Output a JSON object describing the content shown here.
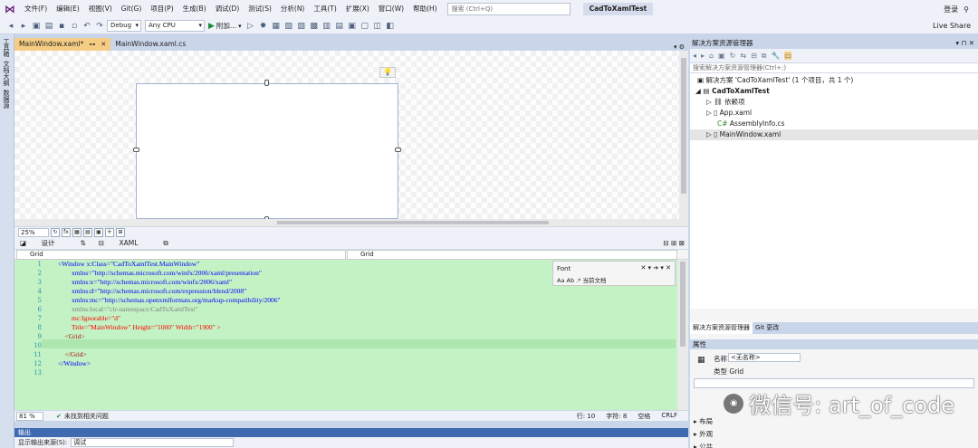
{
  "app": {
    "menu": [
      "文件(F)",
      "编辑(E)",
      "视图(V)",
      "Git(G)",
      "项目(P)",
      "生成(B)",
      "调试(D)",
      "测试(S)",
      "分析(N)",
      "工具(T)",
      "扩展(X)",
      "窗口(W)",
      "帮助(H)"
    ],
    "search_placeholder": "搜索 (Ctrl+Q)",
    "solution_name": "CadToXamlTest",
    "login": "登录",
    "live_share": "Live Share"
  },
  "toolbar": {
    "config": "Debug",
    "platform": "Any CPU",
    "attach": "附加...",
    "attach_arrow": "▾"
  },
  "left_rail": [
    "工具箱",
    "文档大纲",
    "数据源"
  ],
  "doc_tabs": [
    {
      "label": "MainWindow.xaml*",
      "active": true
    },
    {
      "label": "MainWindow.xaml.cs",
      "active": false
    }
  ],
  "zoom": {
    "value": "25%",
    "fx": "fx"
  },
  "split_tabs": {
    "design": "设计",
    "swap": "⇅",
    "xaml": "XAML"
  },
  "scope": {
    "left": "Grid",
    "right": "Grid"
  },
  "editor": {
    "find_query": "Font",
    "find_scope": "当前文档",
    "find_opts": "Aa  Ab  .*",
    "lines": [
      {
        "n": "1",
        "text": "<Window x:Class=\"CadToXamlTest.MainWindow\""
      },
      {
        "n": "2",
        "text": "        xmlns=\"http://schemas.microsoft.com/winfx/2006/xaml/presentation\""
      },
      {
        "n": "3",
        "text": "        xmlns:x=\"http://schemas.microsoft.com/winfx/2006/xaml\""
      },
      {
        "n": "4",
        "text": "        xmlns:d=\"http://schemas.microsoft.com/expression/blend/2008\""
      },
      {
        "n": "5",
        "text": "        xmlns:mc=\"http://schemas.openxmlformats.org/markup-compatibility/2006\""
      },
      {
        "n": "6",
        "text": "        xmlns:local=\"clr-namespace:CadToXamlTest\""
      },
      {
        "n": "7",
        "text": "        mc:Ignorable=\"d\""
      },
      {
        "n": "8",
        "text": "        Title=\"MainWindow\" Height=\"1000\" Width=\"1900\" >"
      },
      {
        "n": "9",
        "text": "    <Grid>"
      },
      {
        "n": "10",
        "text": ""
      },
      {
        "n": "11",
        "text": "    </Grid>"
      },
      {
        "n": "12",
        "text": "</Window>"
      },
      {
        "n": "13",
        "text": ""
      }
    ]
  },
  "status": {
    "zoom": "81 %",
    "issues": "未找到相关问题",
    "line": "行: 10",
    "char": "字符: 8",
    "indent": "空格",
    "eol": "CRLF"
  },
  "output": {
    "title": "输出",
    "source_label": "显示输出来源(S):",
    "source_value": "调试"
  },
  "solution_explorer": {
    "title": "解决方案资源管理器",
    "search_placeholder": "搜索解决方案资源管理器(Ctrl+;)",
    "solution": "解决方案 'CadToXamlTest' (1 个项目，共 1 个)",
    "project": "CadToXamlTest",
    "items": [
      "依赖项",
      "App.xaml",
      "AssemblyInfo.cs",
      "MainWindow.xaml"
    ],
    "bottom_tabs": [
      "解决方案资源管理器",
      "Git 更改"
    ]
  },
  "properties": {
    "title": "属性",
    "name_label": "名称",
    "name_value": "<无名称>",
    "type_label": "类型",
    "type_value": "Grid",
    "groups": [
      "布局",
      "外观",
      "公共"
    ]
  },
  "watermark": "微信号: art_of_code"
}
